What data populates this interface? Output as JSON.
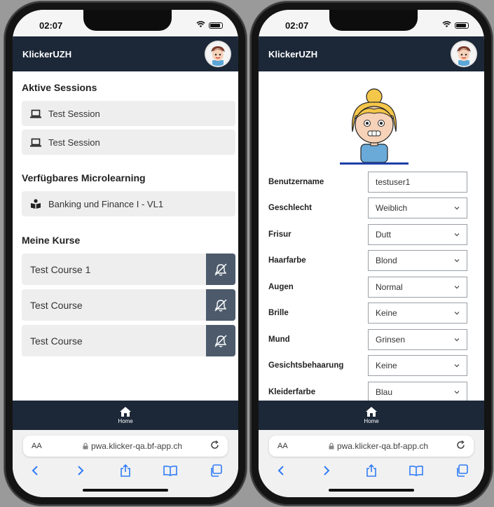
{
  "status": {
    "time": "02:07"
  },
  "app": {
    "title": "KlickerUZH"
  },
  "left": {
    "sections": {
      "sessions": "Aktive Sessions",
      "microlearning": "Verfügbares Microlearning",
      "courses": "Meine Kurse"
    },
    "sessions": [
      {
        "label": "Test Session"
      },
      {
        "label": "Test Session"
      }
    ],
    "microlearning": [
      {
        "label": "Banking und Finance I - VL1"
      }
    ],
    "courses": [
      {
        "label": "Test Course 1"
      },
      {
        "label": "Test Course"
      },
      {
        "label": "Test Course"
      }
    ]
  },
  "tabbar": {
    "home_label": "Home"
  },
  "browser": {
    "aa_label": "AA",
    "url": "pwa.klicker-qa.bf-app.ch"
  },
  "profile": {
    "fields": [
      {
        "label": "Benutzername",
        "value": "testuser1",
        "type": "text"
      },
      {
        "label": "Geschlecht",
        "value": "Weiblich",
        "type": "select"
      },
      {
        "label": "Frisur",
        "value": "Dutt",
        "type": "select"
      },
      {
        "label": "Haarfarbe",
        "value": "Blond",
        "type": "select"
      },
      {
        "label": "Augen",
        "value": "Normal",
        "type": "select"
      },
      {
        "label": "Brille",
        "value": "Keine",
        "type": "select"
      },
      {
        "label": "Mund",
        "value": "Grinsen",
        "type": "select"
      },
      {
        "label": "Gesichtsbehaarung",
        "value": "Keine",
        "type": "select"
      },
      {
        "label": "Kleiderfarbe",
        "value": "Blau",
        "type": "select"
      }
    ]
  },
  "colors": {
    "navy": "#1c2838",
    "bell_bg": "#4c5a6b",
    "item_bg": "#eeeeee",
    "accent_blue": "#1e3ea8"
  }
}
